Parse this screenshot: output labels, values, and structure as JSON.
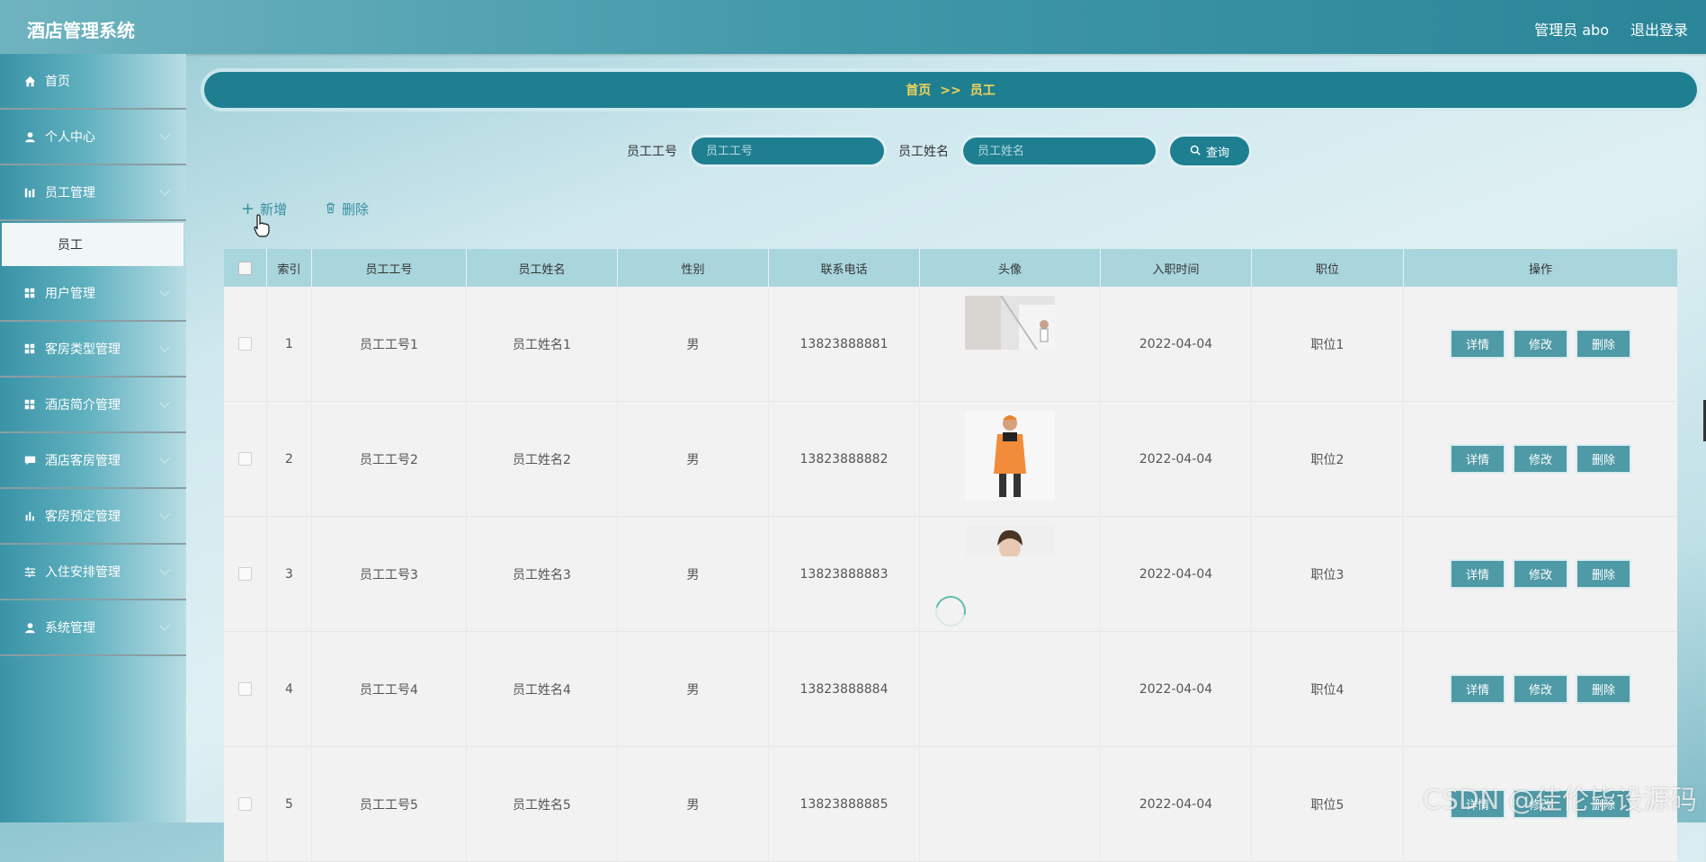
{
  "app": {
    "title": "酒店管理系统",
    "user": "管理员 abo",
    "logout": "退出登录"
  },
  "sidebar": {
    "items": [
      {
        "label": "首页",
        "icon": "home-icon"
      },
      {
        "label": "个人中心",
        "icon": "user-icon"
      },
      {
        "label": "员工管理",
        "icon": "chart-icon"
      },
      {
        "label": "用户管理",
        "icon": "grid-icon"
      },
      {
        "label": "客房类型管理",
        "icon": "grid-icon"
      },
      {
        "label": "酒店简介管理",
        "icon": "grid-icon"
      },
      {
        "label": "酒店客房管理",
        "icon": "chat-icon"
      },
      {
        "label": "客房预定管理",
        "icon": "bar-chart-icon"
      },
      {
        "label": "入住安排管理",
        "icon": "sliders-icon"
      },
      {
        "label": "系统管理",
        "icon": "user-icon"
      }
    ],
    "sub_item": "员工"
  },
  "breadcrumb": {
    "home": "首页",
    "sep": ">>",
    "current": "员工"
  },
  "search": {
    "emp_no_label": "员工工号",
    "emp_no_placeholder": "员工工号",
    "emp_name_label": "员工姓名",
    "emp_name_placeholder": "员工姓名",
    "query_label": "查询"
  },
  "toolbar": {
    "add_label": "新增",
    "delete_label": "删除"
  },
  "table": {
    "headers": [
      "",
      "索引",
      "员工工号",
      "员工姓名",
      "性别",
      "联系电话",
      "头像",
      "入职时间",
      "职位",
      "操作"
    ],
    "actions": {
      "detail": "详情",
      "edit": "修改",
      "delete": "删除"
    },
    "rows": [
      {
        "index": "1",
        "no": "员工工号1",
        "name": "员工姓名1",
        "gender": "男",
        "phone": "13823888881",
        "date": "2022-04-04",
        "position": "职位1"
      },
      {
        "index": "2",
        "no": "员工工号2",
        "name": "员工姓名2",
        "gender": "男",
        "phone": "13823888882",
        "date": "2022-04-04",
        "position": "职位2"
      },
      {
        "index": "3",
        "no": "员工工号3",
        "name": "员工姓名3",
        "gender": "男",
        "phone": "13823888883",
        "date": "2022-04-04",
        "position": "职位3"
      },
      {
        "index": "4",
        "no": "员工工号4",
        "name": "员工姓名4",
        "gender": "男",
        "phone": "13823888884",
        "date": "2022-04-04",
        "position": "职位4"
      },
      {
        "index": "5",
        "no": "员工工号5",
        "name": "员工姓名5",
        "gender": "男",
        "phone": "13823888885",
        "date": "2022-04-04",
        "position": "职位5"
      }
    ]
  },
  "watermark": "CSDN @佳伦毕设源码",
  "colors": {
    "primary": "#1e7f90",
    "breadcrumb_text": "#f3d35b",
    "action_button": "#4e9aa6",
    "table_header": "#a9d5dd"
  }
}
